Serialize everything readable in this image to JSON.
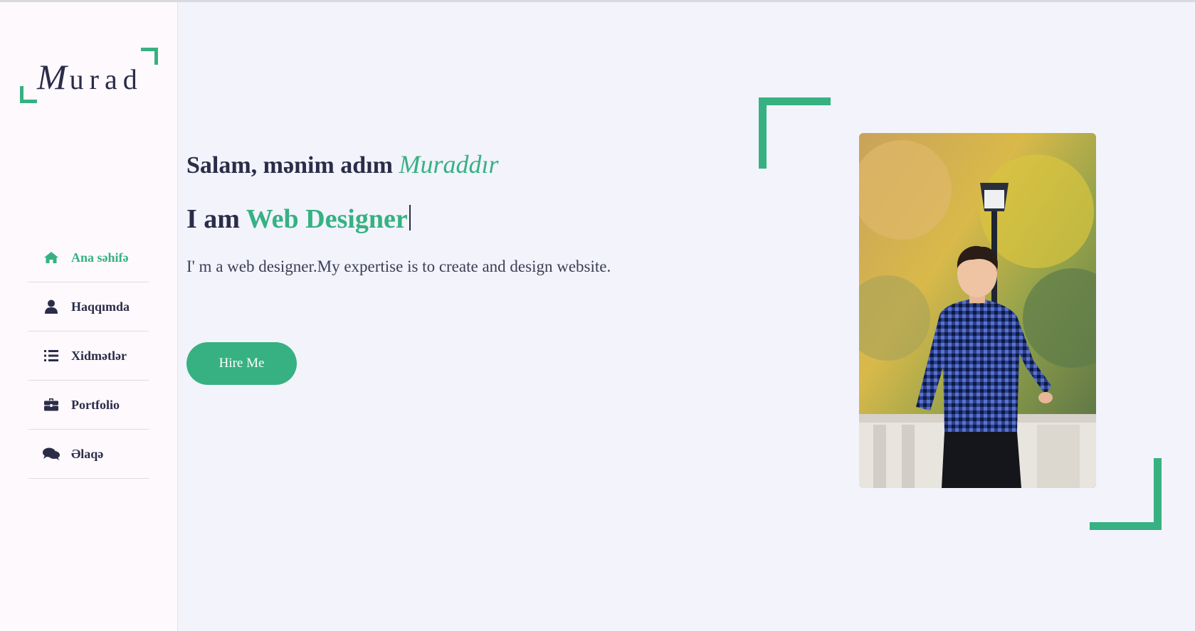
{
  "logo": {
    "first_letter": "M",
    "rest": "urad"
  },
  "nav": {
    "items": [
      {
        "label": "Ana səhifə",
        "icon": "home-icon",
        "active": true
      },
      {
        "label": "Haqqımda",
        "icon": "user-icon",
        "active": false
      },
      {
        "label": "Xidmətlər",
        "icon": "list-icon",
        "active": false
      },
      {
        "label": "Portfolio",
        "icon": "briefcase-icon",
        "active": false
      },
      {
        "label": "Əlaqə",
        "icon": "comments-icon",
        "active": false
      }
    ]
  },
  "hero": {
    "greeting": "Salam, mənim adım ",
    "name": "Muraddır",
    "role_prefix": "I am ",
    "role": "Web Designer",
    "description": "I' m a web designer.My expertise is to create and design website.",
    "button": "Hire Me"
  },
  "colors": {
    "accent": "#37b182",
    "text": "#2b2c48",
    "background": "#f2f3fb",
    "sidebar": "#fdf9fd"
  }
}
